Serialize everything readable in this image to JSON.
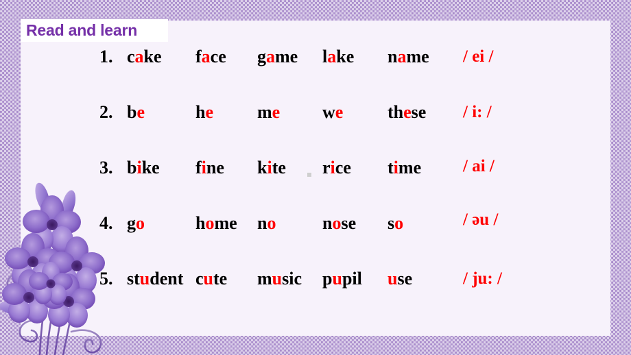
{
  "slide": {
    "title": "Read and learn",
    "title_color": "#7530a8",
    "accent_color": "#ff0000",
    "panel_color": "#f7f2fb",
    "border_color": "#b9a0d6",
    "decoration": "purple-violet-flower-bouquet"
  },
  "rows": [
    {
      "number": "1.",
      "words": [
        {
          "pre": "c",
          "hl": "a",
          "post": "ke"
        },
        {
          "pre": "f",
          "hl": "a",
          "post": "ce"
        },
        {
          "pre": "g",
          "hl": "a",
          "post": "me"
        },
        {
          "pre": "l",
          "hl": "a",
          "post": "ke"
        },
        {
          "pre": "n",
          "hl": "a",
          "post": "me"
        }
      ],
      "phonetic": "/ ei /"
    },
    {
      "number": "2.",
      "words": [
        {
          "pre": "b",
          "hl": "e",
          "post": ""
        },
        {
          "pre": "h",
          "hl": "e",
          "post": ""
        },
        {
          "pre": "m",
          "hl": "e",
          "post": ""
        },
        {
          "pre": "w",
          "hl": "e",
          "post": ""
        },
        {
          "pre": "th",
          "hl": "e",
          "post": "se"
        }
      ],
      "phonetic": "/ i: /"
    },
    {
      "number": "3.",
      "words": [
        {
          "pre": "b",
          "hl": "i",
          "post": "ke"
        },
        {
          "pre": "f",
          "hl": "i",
          "post": "ne"
        },
        {
          "pre": "k",
          "hl": "i",
          "post": "te"
        },
        {
          "pre": "r",
          "hl": "i",
          "post": "ce"
        },
        {
          "pre": "t",
          "hl": "i",
          "post": "me"
        }
      ],
      "phonetic": "/ ai /"
    },
    {
      "number": "4.",
      "words": [
        {
          "pre": "g",
          "hl": "o",
          "post": ""
        },
        {
          "pre": "h",
          "hl": "o",
          "post": "me"
        },
        {
          "pre": "n",
          "hl": "o",
          "post": ""
        },
        {
          "pre": "n",
          "hl": "o",
          "post": "se"
        },
        {
          "pre": "s",
          "hl": "o",
          "post": ""
        }
      ],
      "phonetic": "/ əu /"
    },
    {
      "number": "5.",
      "words": [
        {
          "pre": "st",
          "hl": "u",
          "post": "dent"
        },
        {
          "pre": "c",
          "hl": "u",
          "post": "te"
        },
        {
          "pre": "m",
          "hl": "u",
          "post": "sic"
        },
        {
          "pre": "p",
          "hl": "u",
          "post": "pil"
        },
        {
          "pre": "",
          "hl": "u",
          "post": "se"
        }
      ],
      "phonetic": "/ ju: /"
    }
  ],
  "layout": {
    "row_x": [
      145,
      185,
      285,
      375,
      470,
      565
    ],
    "phonetic_x": [
      675,
      675,
      675,
      675,
      675
    ],
    "row_y": [
      0,
      81,
      162,
      243,
      324
    ]
  }
}
